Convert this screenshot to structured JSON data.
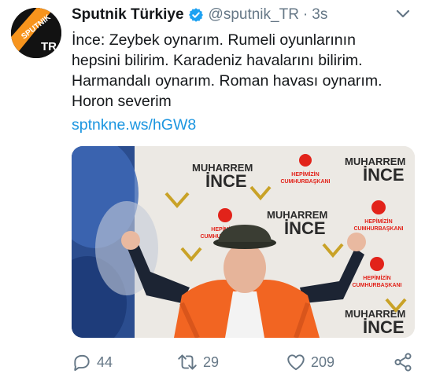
{
  "tweet": {
    "author": {
      "display_name": "Sputnik Türkiye",
      "handle": "@sputnik_TR",
      "verified": true,
      "avatar_text_top": "SPUTNIK",
      "avatar_text_bottom": "TR"
    },
    "separator": "·",
    "timestamp": "3s",
    "text_lines": [
      "İnce: Zeybek oynarım. Rumeli oyunlarının",
      "hepsini bilirim. Karadeniz havalarını bilirim.",
      "Harmandalı oynarım. Roman havası oynarım.",
      "Horon severim"
    ],
    "link": "sptnkne.ws/hGW8",
    "media": {
      "poster_name_top": "MUHARREM",
      "poster_name_bottom": "İNCE",
      "poster_slogan_top": "HEPİMİZİN",
      "poster_slogan_bottom": "CUMHURBAŞKANI"
    },
    "actions": {
      "reply_count": "44",
      "retweet_count": "29",
      "like_count": "209"
    }
  },
  "icons": {
    "verified": "verified-badge-icon",
    "more": "chevron-down-icon",
    "reply": "reply-icon",
    "retweet": "retweet-icon",
    "like": "heart-icon",
    "share": "share-icon"
  },
  "colors": {
    "link": "#1b95e0",
    "verified": "#1da1f2",
    "muted": "#657786",
    "text": "#14171a",
    "poster_red": "#e2231a",
    "vest_orange": "#f26522"
  }
}
